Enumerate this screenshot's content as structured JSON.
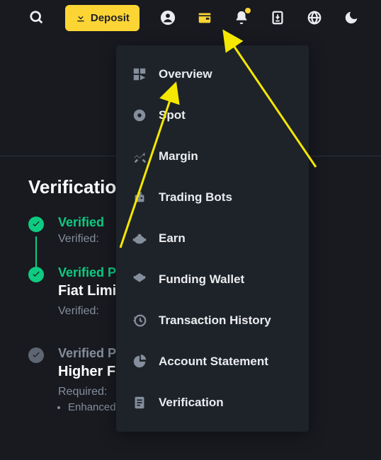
{
  "topbar": {
    "deposit_label": "Deposit"
  },
  "dropdown": {
    "items": [
      {
        "label": "Overview"
      },
      {
        "label": "Spot"
      },
      {
        "label": "Margin"
      },
      {
        "label": "Trading Bots"
      },
      {
        "label": "Earn"
      },
      {
        "label": "Funding Wallet"
      },
      {
        "label": "Transaction History"
      },
      {
        "label": "Account Statement"
      },
      {
        "label": "Verification"
      }
    ]
  },
  "verification": {
    "heading": "Verification",
    "levels": [
      {
        "status": "Verified",
        "sub_label": "Verified:"
      },
      {
        "status": "Verified P",
        "headline": "Fiat Limi",
        "sub_label": "Verified:"
      },
      {
        "status": "Verified P",
        "headline": "Higher F",
        "req_label": "Required:",
        "bullet": "Enhanced due dilligence"
      }
    ]
  }
}
